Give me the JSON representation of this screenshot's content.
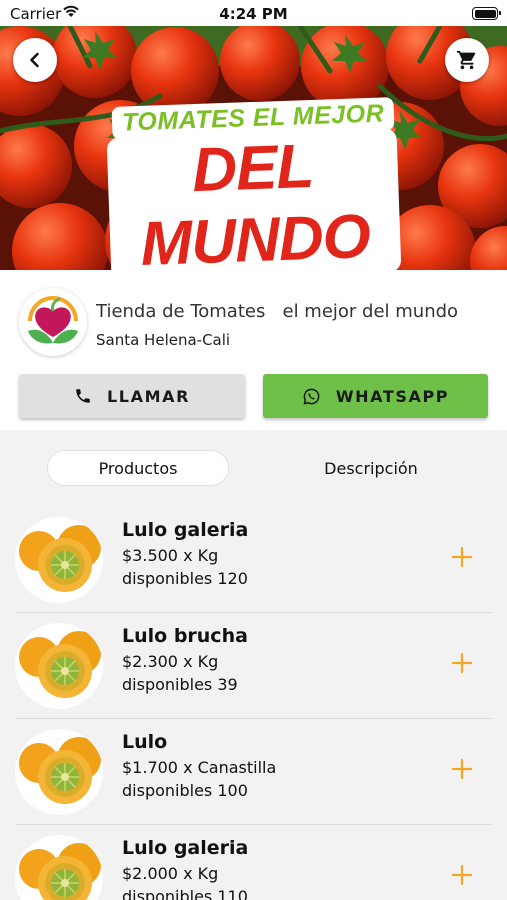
{
  "status_bar": {
    "carrier": "Carrier",
    "time": "4:24 PM"
  },
  "banner": {
    "title_line1": "TOMATES EL MEJOR",
    "title_line2": "DEL MUNDO"
  },
  "store": {
    "name": "Tienda de Tomates   el mejor del mundo",
    "location": "Santa Helena-Cali",
    "call_label": "LLAMAR",
    "whatsapp_label": "WHATSAPP"
  },
  "tabs": [
    {
      "label": "Productos",
      "active": true
    },
    {
      "label": "Descripción",
      "active": false
    }
  ],
  "products": [
    {
      "name": "Lulo galeria",
      "price": "$3.500 x Kg",
      "stock": "disponibles 120"
    },
    {
      "name": "Lulo brucha",
      "price": "$2.300 x Kg",
      "stock": "disponibles 39"
    },
    {
      "name": "Lulo",
      "price": "$1.700 x Canastilla",
      "stock": "disponibles 100"
    },
    {
      "name": "Lulo galeria",
      "price": "$2.000 x Kg",
      "stock": "disponibles 110"
    }
  ],
  "colors": {
    "accent_orange": "#f5a623",
    "whatsapp_green": "#6ec048",
    "call_gray": "#e0e0e0"
  },
  "icons": {
    "back": "chevron-left-icon",
    "cart": "cart-icon",
    "call": "phone-icon",
    "whatsapp": "whatsapp-icon",
    "add": "plus-icon"
  }
}
